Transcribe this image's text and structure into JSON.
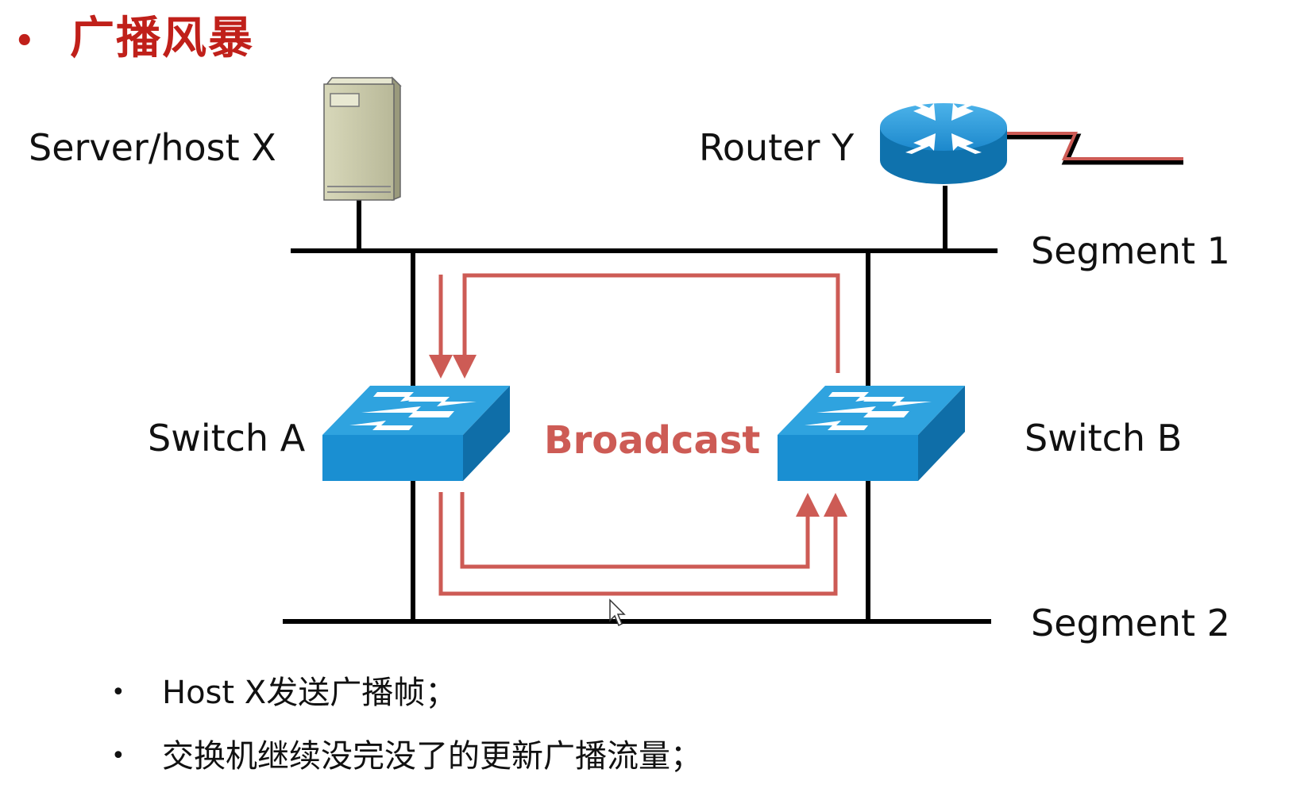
{
  "title": {
    "bullet": "•",
    "text": "广播风暴"
  },
  "labels": {
    "server": "Server/host X",
    "router": "Router Y",
    "segment1": "Segment 1",
    "segment2": "Segment 2",
    "switch_a": "Switch A",
    "switch_b": "Switch B",
    "broadcast": "Broadcast"
  },
  "bullets": [
    {
      "dot": "•",
      "text": "Host X发送广播帧；"
    },
    {
      "dot": "•",
      "text": "交换机继续没完没了的更新广播流量；"
    }
  ],
  "colors": {
    "title": "#c0201a",
    "flow": "#cd5b55",
    "switch_top": "#2a9fdc",
    "switch_side": "#0f6ea8",
    "router": "#1d8fd0",
    "server": "#c8c8a8"
  },
  "icons": {
    "server": "server-icon",
    "router": "router-icon",
    "switch_a": "switch-icon",
    "switch_b": "switch-icon",
    "cursor": "cursor-icon"
  }
}
